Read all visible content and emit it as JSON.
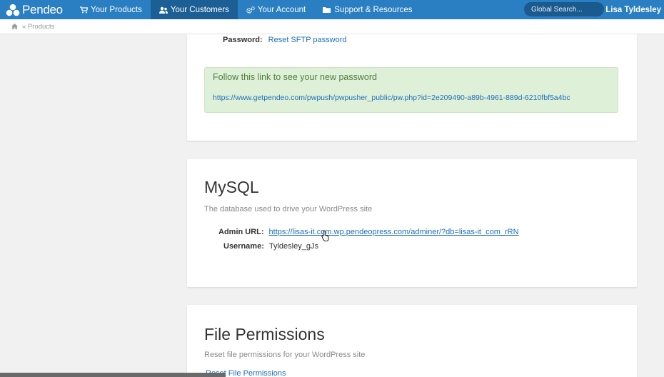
{
  "nav": {
    "logo_text": "Pendeo",
    "items": [
      {
        "label": "Your Products",
        "icon": "cart-icon"
      },
      {
        "label": "Your Customers",
        "icon": "users-icon"
      },
      {
        "label": "Your Account",
        "icon": "gears-icon"
      },
      {
        "label": "Support & Resources",
        "icon": "folder-icon"
      }
    ],
    "search_placeholder": "Global Search...",
    "user_name": "Lisa Tyldesley",
    "active_color": "#1c5f95",
    "bar_color": "#2a7ec2"
  },
  "breadcrumb": {
    "home_icon": "home-icon",
    "text": "« Products"
  },
  "sftp": {
    "password_label": "Password:",
    "reset_link": "Reset SFTP password",
    "notice_text": "Follow this link to see your new password",
    "notice_url": "https://www.getpendeo.com/pwpush/pwpusher_public/pw.php?id=2e209490-a89b-4961-889d-6210fbf5a4bc"
  },
  "mysql": {
    "title": "MySQL",
    "description": "The database used to drive your WordPress site",
    "admin_url_label": "Admin URL:",
    "admin_url": "https://lisas-it.com.wp.pendeopress.com/adminer/?db=lisas-it_com_rRN",
    "username_label": "Username:",
    "username": "Tyldesley_gJs"
  },
  "file_permissions": {
    "title": "File Permissions",
    "description": "Reset file permissions for your WordPress site",
    "reset_link": "Reset File Permissions"
  }
}
